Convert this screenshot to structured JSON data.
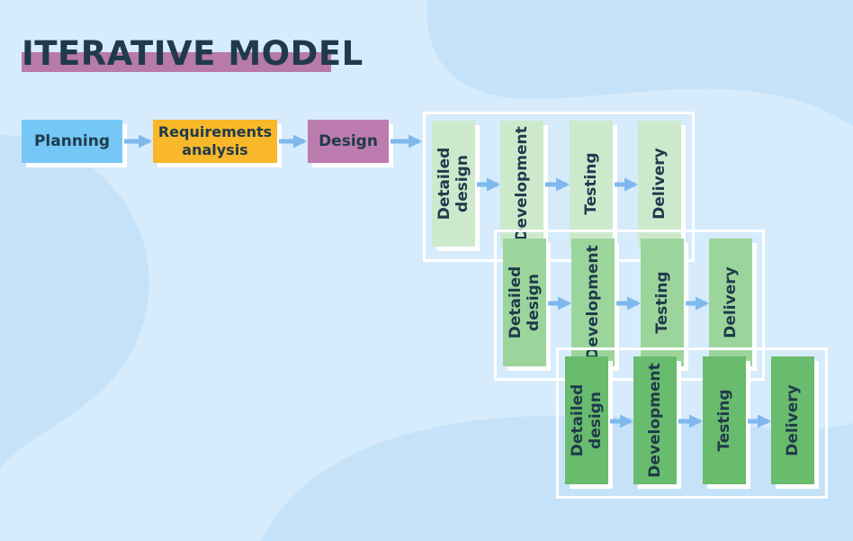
{
  "title": "ITERATIVE MODEL",
  "colors": {
    "title_text": "#1f3a4b",
    "title_highlight": "#b87aaa",
    "planning": "#75c7f5",
    "requirements": "#f8b82a",
    "design": "#bd7caf",
    "iteration_1": "#cde9cc",
    "iteration_2": "#9cd59c",
    "iteration_3": "#69bb6d",
    "arrow": "#7eb8ee"
  },
  "phases": {
    "planning": "Planning",
    "requirements": "Requirements analysis",
    "design": "Design"
  },
  "iterations": [
    {
      "detailed_design": "Detailed design",
      "development": "Development",
      "testing": "Testing",
      "delivery": "Delivery"
    },
    {
      "detailed_design": "Detailed design",
      "development": "Development",
      "testing": "Testing",
      "delivery": "Delivery"
    },
    {
      "detailed_design": "Detailed design",
      "development": "Development",
      "testing": "Testing",
      "delivery": "Delivery"
    }
  ]
}
